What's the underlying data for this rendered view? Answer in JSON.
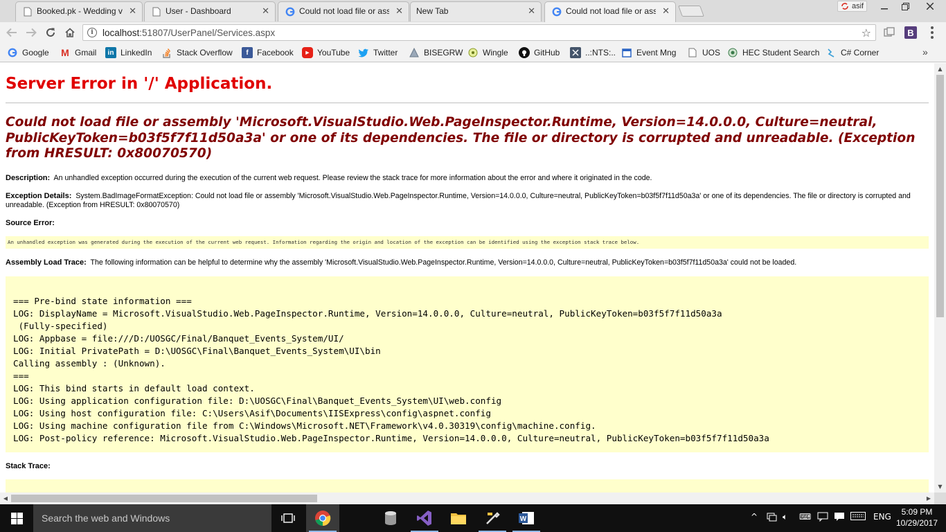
{
  "browser": {
    "tabs": [
      {
        "title": "Booked.pk - Wedding ve"
      },
      {
        "title": "User - Dashboard"
      },
      {
        "title": "Could not load file or ass"
      },
      {
        "title": "New Tab"
      },
      {
        "title": "Could not load file or ass"
      }
    ],
    "user_chip": "asif",
    "url_host": "localhost",
    "url_path": ":51807/UserPanel/Services.aspx",
    "bookmarks": [
      {
        "label": "Google"
      },
      {
        "label": "Gmail"
      },
      {
        "label": "LinkedIn"
      },
      {
        "label": "Stack Overflow"
      },
      {
        "label": "Facebook"
      },
      {
        "label": "YouTube"
      },
      {
        "label": "Twitter"
      },
      {
        "label": "BISEGRW"
      },
      {
        "label": "Wingle"
      },
      {
        "label": "GitHub"
      },
      {
        "label": "..:NTS:.."
      },
      {
        "label": "Event Mng"
      },
      {
        "label": "UOS"
      },
      {
        "label": "HEC Student Search"
      },
      {
        "label": "C# Corner"
      }
    ],
    "more_bookmarks": "»"
  },
  "page": {
    "server_title": "Server Error in '/' Application.",
    "exception_heading": "Could not load file or assembly 'Microsoft.VisualStudio.Web.PageInspector.Runtime, Version=14.0.0.0, Culture=neutral, PublicKeyToken=b03f5f7f11d50a3a' or one of its dependencies. The file or directory is corrupted and unreadable. (Exception from HRESULT: 0x80070570)",
    "description_label": "Description:",
    "description_text": "An unhandled exception occurred during the execution of the current web request. Please review the stack trace for more information about the error and where it originated in the code.",
    "exception_details_label": "Exception Details:",
    "exception_details_text": "System.BadImageFormatException: Could not load file or assembly 'Microsoft.VisualStudio.Web.PageInspector.Runtime, Version=14.0.0.0, Culture=neutral, PublicKeyToken=b03f5f7f11d50a3a' or one of its dependencies. The file or directory is corrupted and unreadable. (Exception from HRESULT: 0x80070570)",
    "source_error_label": "Source Error:",
    "source_error_text": "An unhandled exception was generated during the execution of the current web request. Information regarding the origin and location of the exception can be identified using the exception stack trace below.",
    "assembly_trace_label": "Assembly Load Trace:",
    "assembly_trace_text": "The following information can be helpful to determine why the assembly 'Microsoft.VisualStudio.Web.PageInspector.Runtime, Version=14.0.0.0, Culture=neutral, PublicKeyToken=b03f5f7f11d50a3a' could not be loaded.",
    "trace_lines": [
      "=== Pre-bind state information ===",
      "LOG: DisplayName = Microsoft.VisualStudio.Web.PageInspector.Runtime, Version=14.0.0.0, Culture=neutral, PublicKeyToken=b03f5f7f11d50a3a",
      " (Fully-specified)",
      "LOG: Appbase = file:///D:/UOSGC/Final/Banquet_Events_System/UI/",
      "LOG: Initial PrivatePath = D:\\UOSGC\\Final\\Banquet_Events_System\\UI\\bin",
      "Calling assembly : (Unknown).",
      "===",
      "LOG: This bind starts in default load context.",
      "LOG: Using application configuration file: D:\\UOSGC\\Final\\Banquet_Events_System\\UI\\web.config",
      "LOG: Using host configuration file: C:\\Users\\Asif\\Documents\\IISExpress\\config\\aspnet.config",
      "LOG: Using machine configuration file from C:\\Windows\\Microsoft.NET\\Framework\\v4.0.30319\\config\\machine.config.",
      "LOG: Post-policy reference: Microsoft.VisualStudio.Web.PageInspector.Runtime, Version=14.0.0.0, Culture=neutral, PublicKeyToken=b03f5f7f11d50a3a"
    ],
    "stack_trace_label": "Stack Trace:"
  },
  "taskbar": {
    "search_placeholder": "Search the web and Windows",
    "language": "ENG",
    "time": "5:09 PM",
    "date": "10/29/2017"
  },
  "colors": {
    "error_title": "#e00000",
    "exception_heading": "#800000",
    "code_background": "#ffffcc",
    "taskbar": "#101010"
  }
}
